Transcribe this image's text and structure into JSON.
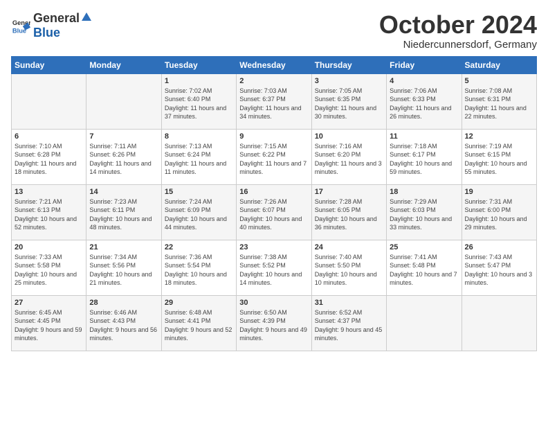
{
  "logo": {
    "general": "General",
    "blue": "Blue"
  },
  "title": "October 2024",
  "location": "Niedercunnersdorf, Germany",
  "headers": [
    "Sunday",
    "Monday",
    "Tuesday",
    "Wednesday",
    "Thursday",
    "Friday",
    "Saturday"
  ],
  "weeks": [
    [
      {
        "day": "",
        "sunrise": "",
        "sunset": "",
        "daylight": ""
      },
      {
        "day": "",
        "sunrise": "",
        "sunset": "",
        "daylight": ""
      },
      {
        "day": "1",
        "sunrise": "Sunrise: 7:02 AM",
        "sunset": "Sunset: 6:40 PM",
        "daylight": "Daylight: 11 hours and 37 minutes."
      },
      {
        "day": "2",
        "sunrise": "Sunrise: 7:03 AM",
        "sunset": "Sunset: 6:37 PM",
        "daylight": "Daylight: 11 hours and 34 minutes."
      },
      {
        "day": "3",
        "sunrise": "Sunrise: 7:05 AM",
        "sunset": "Sunset: 6:35 PM",
        "daylight": "Daylight: 11 hours and 30 minutes."
      },
      {
        "day": "4",
        "sunrise": "Sunrise: 7:06 AM",
        "sunset": "Sunset: 6:33 PM",
        "daylight": "Daylight: 11 hours and 26 minutes."
      },
      {
        "day": "5",
        "sunrise": "Sunrise: 7:08 AM",
        "sunset": "Sunset: 6:31 PM",
        "daylight": "Daylight: 11 hours and 22 minutes."
      }
    ],
    [
      {
        "day": "6",
        "sunrise": "Sunrise: 7:10 AM",
        "sunset": "Sunset: 6:28 PM",
        "daylight": "Daylight: 11 hours and 18 minutes."
      },
      {
        "day": "7",
        "sunrise": "Sunrise: 7:11 AM",
        "sunset": "Sunset: 6:26 PM",
        "daylight": "Daylight: 11 hours and 14 minutes."
      },
      {
        "day": "8",
        "sunrise": "Sunrise: 7:13 AM",
        "sunset": "Sunset: 6:24 PM",
        "daylight": "Daylight: 11 hours and 11 minutes."
      },
      {
        "day": "9",
        "sunrise": "Sunrise: 7:15 AM",
        "sunset": "Sunset: 6:22 PM",
        "daylight": "Daylight: 11 hours and 7 minutes."
      },
      {
        "day": "10",
        "sunrise": "Sunrise: 7:16 AM",
        "sunset": "Sunset: 6:20 PM",
        "daylight": "Daylight: 11 hours and 3 minutes."
      },
      {
        "day": "11",
        "sunrise": "Sunrise: 7:18 AM",
        "sunset": "Sunset: 6:17 PM",
        "daylight": "Daylight: 10 hours and 59 minutes."
      },
      {
        "day": "12",
        "sunrise": "Sunrise: 7:19 AM",
        "sunset": "Sunset: 6:15 PM",
        "daylight": "Daylight: 10 hours and 55 minutes."
      }
    ],
    [
      {
        "day": "13",
        "sunrise": "Sunrise: 7:21 AM",
        "sunset": "Sunset: 6:13 PM",
        "daylight": "Daylight: 10 hours and 52 minutes."
      },
      {
        "day": "14",
        "sunrise": "Sunrise: 7:23 AM",
        "sunset": "Sunset: 6:11 PM",
        "daylight": "Daylight: 10 hours and 48 minutes."
      },
      {
        "day": "15",
        "sunrise": "Sunrise: 7:24 AM",
        "sunset": "Sunset: 6:09 PM",
        "daylight": "Daylight: 10 hours and 44 minutes."
      },
      {
        "day": "16",
        "sunrise": "Sunrise: 7:26 AM",
        "sunset": "Sunset: 6:07 PM",
        "daylight": "Daylight: 10 hours and 40 minutes."
      },
      {
        "day": "17",
        "sunrise": "Sunrise: 7:28 AM",
        "sunset": "Sunset: 6:05 PM",
        "daylight": "Daylight: 10 hours and 36 minutes."
      },
      {
        "day": "18",
        "sunrise": "Sunrise: 7:29 AM",
        "sunset": "Sunset: 6:03 PM",
        "daylight": "Daylight: 10 hours and 33 minutes."
      },
      {
        "day": "19",
        "sunrise": "Sunrise: 7:31 AM",
        "sunset": "Sunset: 6:00 PM",
        "daylight": "Daylight: 10 hours and 29 minutes."
      }
    ],
    [
      {
        "day": "20",
        "sunrise": "Sunrise: 7:33 AM",
        "sunset": "Sunset: 5:58 PM",
        "daylight": "Daylight: 10 hours and 25 minutes."
      },
      {
        "day": "21",
        "sunrise": "Sunrise: 7:34 AM",
        "sunset": "Sunset: 5:56 PM",
        "daylight": "Daylight: 10 hours and 21 minutes."
      },
      {
        "day": "22",
        "sunrise": "Sunrise: 7:36 AM",
        "sunset": "Sunset: 5:54 PM",
        "daylight": "Daylight: 10 hours and 18 minutes."
      },
      {
        "day": "23",
        "sunrise": "Sunrise: 7:38 AM",
        "sunset": "Sunset: 5:52 PM",
        "daylight": "Daylight: 10 hours and 14 minutes."
      },
      {
        "day": "24",
        "sunrise": "Sunrise: 7:40 AM",
        "sunset": "Sunset: 5:50 PM",
        "daylight": "Daylight: 10 hours and 10 minutes."
      },
      {
        "day": "25",
        "sunrise": "Sunrise: 7:41 AM",
        "sunset": "Sunset: 5:48 PM",
        "daylight": "Daylight: 10 hours and 7 minutes."
      },
      {
        "day": "26",
        "sunrise": "Sunrise: 7:43 AM",
        "sunset": "Sunset: 5:47 PM",
        "daylight": "Daylight: 10 hours and 3 minutes."
      }
    ],
    [
      {
        "day": "27",
        "sunrise": "Sunrise: 6:45 AM",
        "sunset": "Sunset: 4:45 PM",
        "daylight": "Daylight: 9 hours and 59 minutes."
      },
      {
        "day": "28",
        "sunrise": "Sunrise: 6:46 AM",
        "sunset": "Sunset: 4:43 PM",
        "daylight": "Daylight: 9 hours and 56 minutes."
      },
      {
        "day": "29",
        "sunrise": "Sunrise: 6:48 AM",
        "sunset": "Sunset: 4:41 PM",
        "daylight": "Daylight: 9 hours and 52 minutes."
      },
      {
        "day": "30",
        "sunrise": "Sunrise: 6:50 AM",
        "sunset": "Sunset: 4:39 PM",
        "daylight": "Daylight: 9 hours and 49 minutes."
      },
      {
        "day": "31",
        "sunrise": "Sunrise: 6:52 AM",
        "sunset": "Sunset: 4:37 PM",
        "daylight": "Daylight: 9 hours and 45 minutes."
      },
      {
        "day": "",
        "sunrise": "",
        "sunset": "",
        "daylight": ""
      },
      {
        "day": "",
        "sunrise": "",
        "sunset": "",
        "daylight": ""
      }
    ]
  ]
}
